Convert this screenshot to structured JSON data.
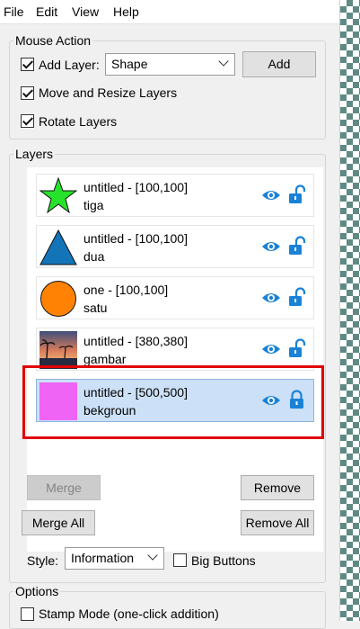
{
  "menu": {
    "file": "File",
    "edit": "Edit",
    "view": "View",
    "help": "Help"
  },
  "mouse_action": {
    "title": "Mouse Action",
    "add_layer_label": "Add Layer:",
    "add_layer_value": "Shape",
    "add_button": "Add",
    "move_resize_label": "Move and Resize Layers",
    "rotate_label": "Rotate Layers"
  },
  "layers": {
    "title": "Layers",
    "items": [
      {
        "title": "untitled - [100,100]",
        "name": "tiga",
        "thumb": "green-star-icon"
      },
      {
        "title": "untitled - [100,100]",
        "name": "dua",
        "thumb": "blue-triangle-icon"
      },
      {
        "title": "one - [100,100]",
        "name": "satu",
        "thumb": "orange-circle-icon"
      },
      {
        "title": "untitled - [380,380]",
        "name": "gambar",
        "thumb": "sunset-photo"
      },
      {
        "title": "untitled - [500,500]",
        "name": "bekgroun",
        "thumb": "magenta-square"
      }
    ],
    "merge": "Merge",
    "remove": "Remove",
    "merge_all": "Merge All",
    "remove_all": "Remove All",
    "style_label": "Style:",
    "style_value": "Information",
    "big_buttons_label": "Big Buttons"
  },
  "options": {
    "title": "Options",
    "stamp_mode_label": "Stamp Mode (one-click addition)"
  },
  "colors": {
    "accent": "#1a82d6",
    "selection": "#cce0f7",
    "highlight": "#e10000"
  }
}
